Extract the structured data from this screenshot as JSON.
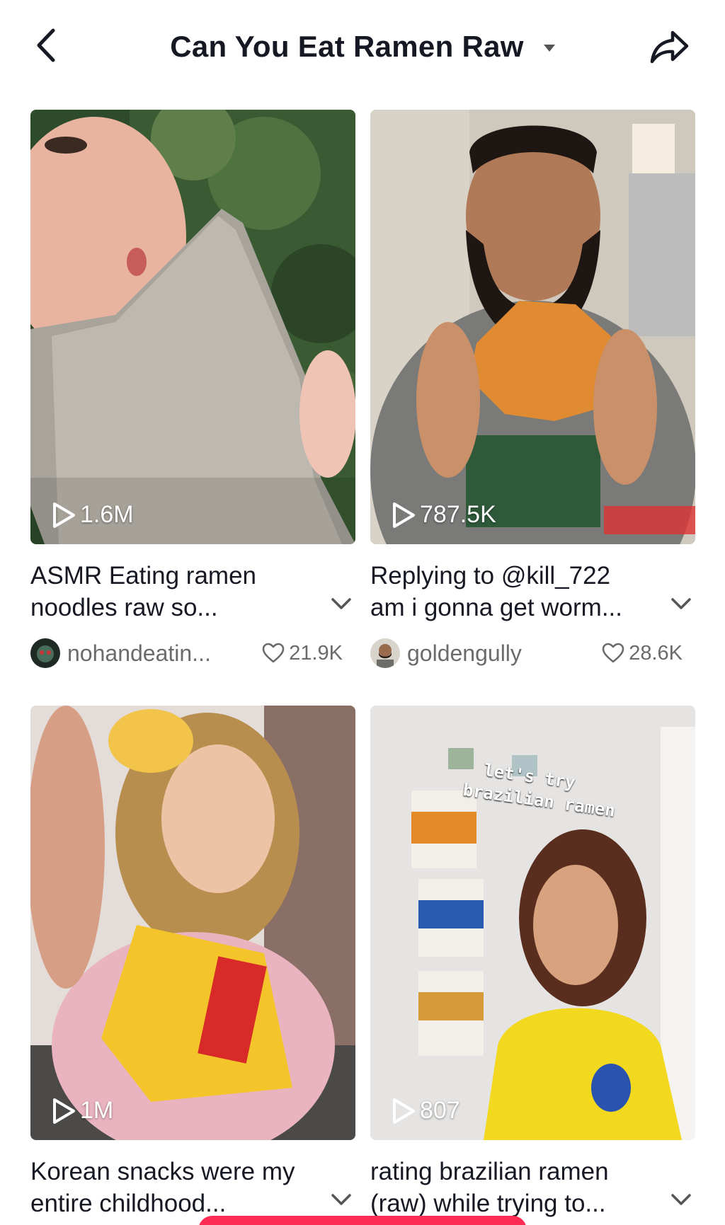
{
  "header": {
    "title": "Can You Eat Ramen Raw"
  },
  "videos": [
    {
      "views": "1.6M",
      "caption_line1": "ASMR Eating ramen",
      "caption_line2": "noodles raw so...",
      "username": "nohandeatin...",
      "likes": "21.9K"
    },
    {
      "views": "787.5K",
      "caption_line1": "Replying to @kill_722",
      "caption_line2": "am i gonna get worm...",
      "username": "goldengully",
      "likes": "28.6K"
    },
    {
      "views": "1M",
      "caption_line1": "Korean snacks were my",
      "caption_line2": "entire childhood...",
      "username": "",
      "likes": ""
    },
    {
      "views": "807",
      "caption_line1": "rating brazilian ramen",
      "caption_line2": "(raw) while trying to...",
      "username": "",
      "likes": "",
      "overlay_line1": "let's try",
      "overlay_line2": "brazilian ramen"
    }
  ],
  "colors": {
    "accent": "#fe2c55",
    "muted_text": "#6b6b6b",
    "primary_text": "#161823"
  },
  "icons": {
    "back": "chevron-left-icon",
    "dropdown": "caret-down-icon",
    "share": "share-arrow-icon",
    "play": "play-outline-icon",
    "heart": "heart-outline-icon",
    "expand": "chevron-down-icon"
  }
}
